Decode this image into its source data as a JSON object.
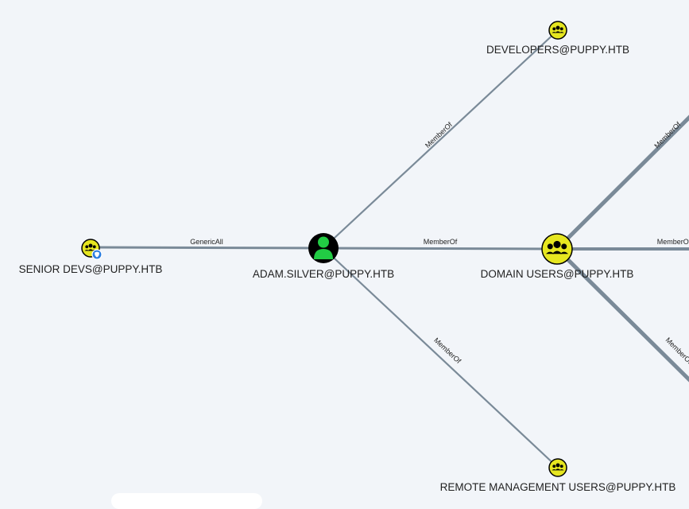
{
  "nodes": {
    "adam": {
      "label": "ADAM.SILVER@PUPPY.HTB",
      "kind": "user",
      "color": "#000000",
      "accent": "#22cc44"
    },
    "domain_users": {
      "label": "DOMAIN USERS@PUPPY.HTB",
      "kind": "group",
      "color": "#e6e620"
    },
    "developers": {
      "label": "DEVELOPERS@PUPPY.HTB",
      "kind": "group",
      "color": "#e6e620"
    },
    "remote_mgmt": {
      "label": "REMOTE MANAGEMENT USERS@PUPPY.HTB",
      "kind": "group",
      "color": "#e6e620"
    },
    "senior_devs": {
      "label": "SENIOR DEVS@PUPPY.HTB",
      "kind": "group",
      "color": "#e6e620",
      "badge_color": "#2a7de1"
    }
  },
  "edges": {
    "generic_all": "GenericAll",
    "member_of": "MemberOf"
  },
  "colors": {
    "background": "#f2f5f9",
    "edge": "#7a8a98"
  }
}
